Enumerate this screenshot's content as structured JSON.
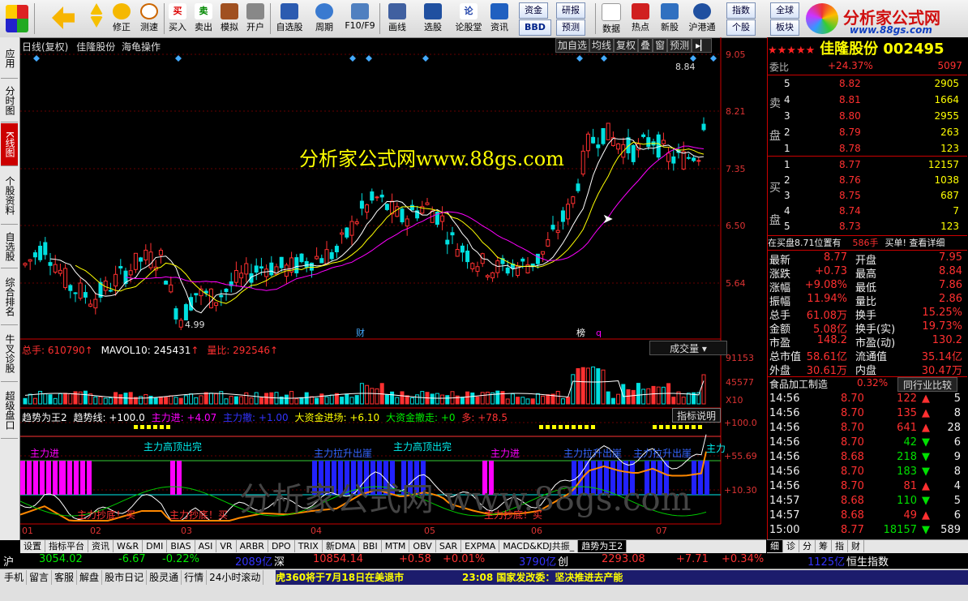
{
  "toolbar": {
    "buttons": [
      {
        "label": "",
        "name": "layout-grid-icon"
      },
      {
        "label": "",
        "name": "back-arrow-icon"
      },
      {
        "label": "修正",
        "name": "fix-button"
      },
      {
        "label": "测速",
        "name": "speed-test-button"
      },
      {
        "label": "买入",
        "name": "buy-button"
      },
      {
        "label": "卖出",
        "name": "sell-button"
      },
      {
        "label": "模拟",
        "name": "simulate-button"
      },
      {
        "label": "开户",
        "name": "open-account-button"
      },
      {
        "label": "自选股",
        "name": "watchlist-button"
      },
      {
        "label": "周期",
        "name": "period-button"
      },
      {
        "label": "F10/F9",
        "name": "f10-button"
      },
      {
        "label": "画线",
        "name": "draw-line-button"
      },
      {
        "label": "选股",
        "name": "select-stock-button"
      },
      {
        "label": "论股堂",
        "name": "forum-button"
      },
      {
        "label": "资讯",
        "name": "news-button"
      },
      {
        "label": "数据",
        "name": "data-button"
      },
      {
        "label": "热点",
        "name": "hotspot-button"
      },
      {
        "label": "新股",
        "name": "new-stock-button"
      },
      {
        "label": "沪港通",
        "name": "hk-connect-button"
      }
    ],
    "fund_label": "资金",
    "research_label": "研报",
    "bbd_label": "BBD",
    "forecast_label": "预测",
    "index_label": "指数",
    "global_label": "全球",
    "individual_label": "个股",
    "sector_label": "板块",
    "logo_text": "分析家公式网",
    "logo_url": "www.88gs.com"
  },
  "left_tabs": [
    "应用",
    "分时图",
    "K线图",
    "个股资料",
    "自选股",
    "综合排名",
    "牛叉诊股",
    "超级盘口"
  ],
  "chart_header": {
    "title": "日线(复权)",
    "stock_name": "佳隆股份",
    "formula": "海龟操作",
    "buttons": [
      "加自选",
      "均线",
      "复权",
      "叠",
      "窗",
      "预测"
    ],
    "watermark": "分析家公式网www.88gs.com",
    "watermark2": "分析家公式网 www.88gs.com",
    "price_high_label": "8.84",
    "price_low_label": "4.99",
    "marker_cai": "财",
    "marker_bang": "榜",
    "marker_q": "q"
  },
  "price_axis": [
    "9.05",
    "8.21",
    "7.35",
    "6.50",
    "5.64"
  ],
  "volume_panel": {
    "total_label": "总手: 610790",
    "mavol_label": "MAVOL10: 245431",
    "ratio_label": "量比: 292546",
    "selector": "成交量",
    "axis": [
      "91153",
      "45577",
      "X10"
    ]
  },
  "indicator_panel": {
    "name": "趋势为王2",
    "trend_label": "趋势线: +100.0",
    "main_in_label": "主力进: +4.07",
    "main_out_label": "主力撤: +1.00",
    "big_in_label": "大资金进场: +6.10",
    "big_out_label": "大资金撤走: +0",
    "more_label": "多: +78.5",
    "help_button": "指标说明",
    "axis": [
      "+100.0",
      "+55.69",
      "+10.30"
    ],
    "annotations": [
      "主力进",
      "主力高顶出完",
      "主力抄底！买",
      "主力抄底！买",
      "主力拉升出崖",
      "主力高顶出完",
      "主力进",
      "主力抄底！买",
      "主力拉升出崖",
      "主力拉升出崖",
      "主力"
    ]
  },
  "x_axis": [
    "01",
    "02",
    "03",
    "04",
    "05",
    "06",
    "07"
  ],
  "bottom_tabs": [
    "设置",
    "指标平台",
    "资讯",
    "W&R",
    "DMI",
    "BIAS",
    "ASI",
    "VR",
    "ARBR",
    "DPO",
    "TRIX",
    "新DMA",
    "BBI",
    "MTM",
    "OBV",
    "SAR",
    "EXPMA",
    "MACD&KDJ共振_",
    "趋势为王2"
  ],
  "right_tabs": [
    "细",
    "诊",
    "分",
    "筹",
    "指",
    "财"
  ],
  "quote": {
    "stock_title": "佳隆股份 002495",
    "wei_bi": {
      "label": "委比",
      "value": "+24.37%",
      "diff": "5097"
    },
    "sell": [
      {
        "level": "5",
        "price": "8.82",
        "vol": "2905"
      },
      {
        "level": "4",
        "price": "8.81",
        "vol": "1664"
      },
      {
        "level": "3",
        "price": "8.80",
        "vol": "2955"
      },
      {
        "level": "2",
        "price": "8.79",
        "vol": "263"
      },
      {
        "level": "1",
        "price": "8.78",
        "vol": "123"
      }
    ],
    "buy": [
      {
        "level": "1",
        "price": "8.77",
        "vol": "12157"
      },
      {
        "level": "2",
        "price": "8.76",
        "vol": "1038"
      },
      {
        "level": "3",
        "price": "8.75",
        "vol": "687"
      },
      {
        "level": "4",
        "price": "8.74",
        "vol": "7"
      },
      {
        "level": "5",
        "price": "8.73",
        "vol": "123"
      }
    ],
    "sell_label": "卖盘",
    "buy_label": "买盘",
    "order_line": "在买盘8.71位置有",
    "order_qty": "586手",
    "order_tail": "买单! 查看详细",
    "stats": [
      [
        "最新",
        "8.77",
        "开盘",
        "7.95"
      ],
      [
        "涨跌",
        "+0.73",
        "最高",
        "8.84"
      ],
      [
        "涨幅",
        "+9.08%",
        "最低",
        "7.86"
      ],
      [
        "振幅",
        "11.94%",
        "量比",
        "2.86"
      ],
      [
        "总手",
        "61.08万",
        "换手",
        "15.25%"
      ],
      [
        "金额",
        "5.08亿",
        "换手(实)",
        "19.73%"
      ],
      [
        "市盈",
        "148.2",
        "市盈(动)",
        "130.2"
      ],
      [
        "总市值",
        "58.61亿",
        "流通值",
        "35.14亿"
      ],
      [
        "外盘",
        "30.61万",
        "内盘",
        "30.47万"
      ]
    ],
    "industry": "食品加工制造",
    "industry_pct": "0.32%",
    "industry_link": "同行业比较",
    "ticks": [
      {
        "time": "14:56",
        "price": "8.70",
        "vol": "122",
        "dir": "up",
        "n": "5"
      },
      {
        "time": "14:56",
        "price": "8.70",
        "vol": "135",
        "dir": "up",
        "n": "8"
      },
      {
        "time": "14:56",
        "price": "8.70",
        "vol": "641",
        "dir": "up",
        "n": "28"
      },
      {
        "time": "14:56",
        "price": "8.70",
        "vol": "42",
        "dir": "down",
        "n": "6"
      },
      {
        "time": "14:56",
        "price": "8.68",
        "vol": "218",
        "dir": "down",
        "n": "9"
      },
      {
        "time": "14:56",
        "price": "8.70",
        "vol": "183",
        "dir": "down",
        "n": "8"
      },
      {
        "time": "14:56",
        "price": "8.70",
        "vol": "81",
        "dir": "up",
        "n": "4"
      },
      {
        "time": "14:57",
        "price": "8.68",
        "vol": "110",
        "dir": "down",
        "n": "5"
      },
      {
        "time": "14:57",
        "price": "8.68",
        "vol": "49",
        "dir": "up",
        "n": "6"
      },
      {
        "time": "15:00",
        "price": "8.77",
        "vol": "18157",
        "dir": "down",
        "n": "589"
      }
    ]
  },
  "index_bar": {
    "sh_label": "沪",
    "sh_value": "3054.02",
    "sh_change": "-6.67",
    "sh_pct": "-0.22%",
    "sh_amount": "2089亿",
    "sz_label": "深",
    "sz_value": "10854.14",
    "sz_change": "+0.58",
    "sz_pct": "+0.01%",
    "sz_amount": "3790亿",
    "cy_label": "创",
    "cy_value": "2293.08",
    "cy_change": "+7.71",
    "cy_pct": "+0.34%",
    "cy_amount": "1125亿",
    "hs_label": "恒生指数"
  },
  "status_bar": {
    "items": [
      "手机",
      "留言",
      "客服",
      "解盘",
      "股市日记",
      "股灵通",
      "行情",
      "24小时滚动"
    ],
    "ticker1": "虎360将于7月18日在美退市",
    "ticker2": "23:08 国家发改委：坚决推进去产能"
  },
  "colors": {
    "up": "#ff3030",
    "down": "#00e0e0",
    "axis": "#cc2020",
    "ma": "#ffffff"
  }
}
